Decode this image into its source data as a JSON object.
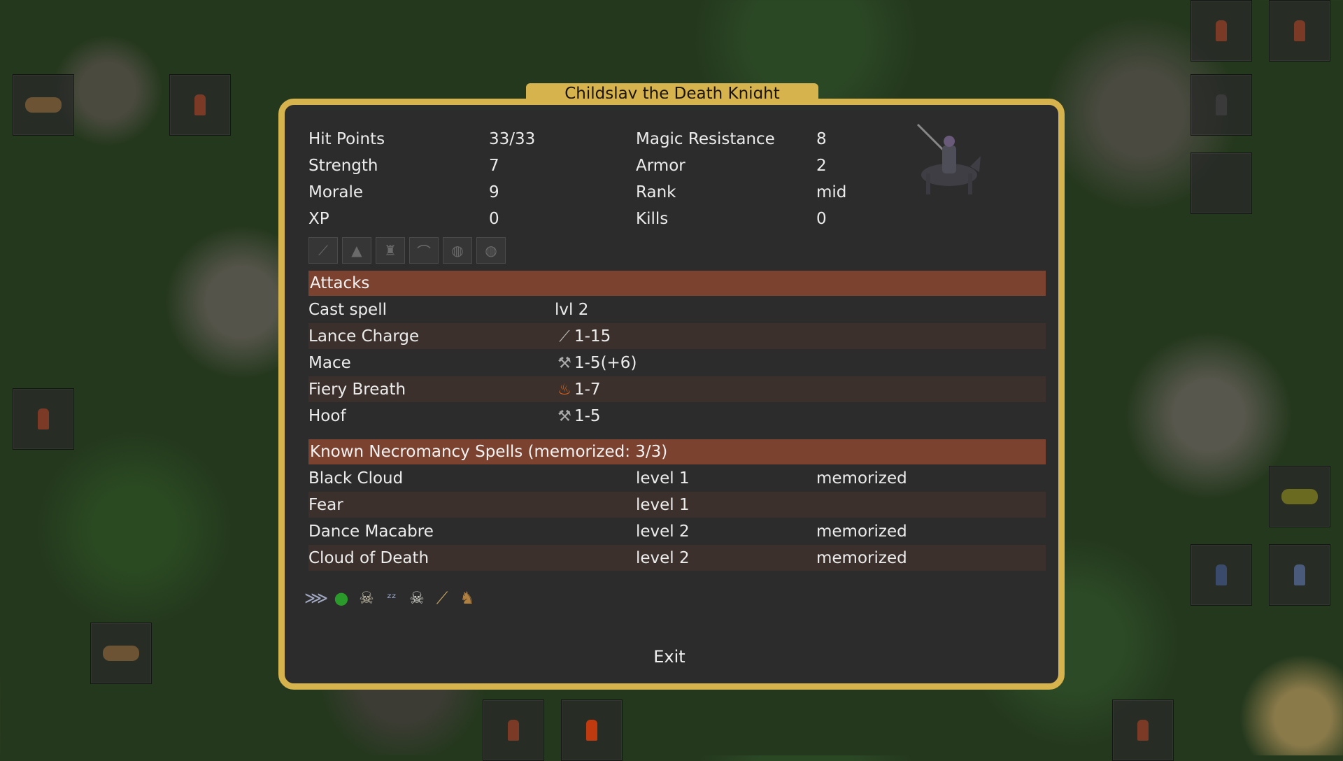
{
  "title": "Childslay the Death Knight",
  "stats": {
    "hit_points_label": "Hit Points",
    "hit_points": "33/33",
    "strength_label": "Strength",
    "strength": "7",
    "morale_label": "Morale",
    "morale": "9",
    "xp_label": "XP",
    "xp": "0",
    "magic_res_label": "Magic Resistance",
    "magic_res": "8",
    "armor_label": "Armor",
    "armor": "2",
    "rank_label": "Rank",
    "rank": "mid",
    "kills_label": "Kills",
    "kills": "0"
  },
  "equipment_icons": [
    "sword-icon",
    "helmet-icon",
    "armor-icon",
    "boots-icon",
    "ring-icon",
    "amulet-icon"
  ],
  "attacks": {
    "header": "Attacks",
    "rows": [
      {
        "name": "Cast spell",
        "icon": "",
        "value": "lvl 2"
      },
      {
        "name": "Lance Charge",
        "icon": "lance-icon",
        "value": "1-15"
      },
      {
        "name": "Mace",
        "icon": "mace-icon",
        "value": "1-5(+6)"
      },
      {
        "name": "Fiery Breath",
        "icon": "fire-icon",
        "value": "1-7"
      },
      {
        "name": "Hoof",
        "icon": "hoof-icon",
        "value": "1-5"
      }
    ]
  },
  "spells": {
    "header": "Known Necromancy Spells (memorized: 3/3)",
    "rows": [
      {
        "name": "Black Cloud",
        "level": "level 1",
        "status": "memorized"
      },
      {
        "name": "Fear",
        "level": "level 1",
        "status": ""
      },
      {
        "name": "Dance Macabre",
        "level": "level 2",
        "status": "memorized"
      },
      {
        "name": "Cloud of Death",
        "level": "level 2",
        "status": "memorized"
      }
    ]
  },
  "ability_icons": [
    "wings-icon",
    "poison-drop-icon",
    "skull-icon",
    "sleep-icon",
    "undead-skull-icon",
    "lance-icon",
    "horse-icon"
  ],
  "exit_label": "Exit",
  "colors": {
    "border": "#d6b34c",
    "header": "#7b4230",
    "panel": "#2c2c2d"
  }
}
